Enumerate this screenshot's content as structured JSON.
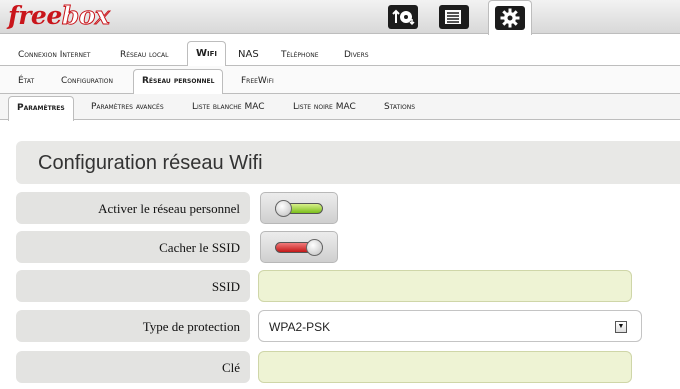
{
  "brand": {
    "logo_free": "free",
    "logo_box": "box"
  },
  "top_icons": [
    {
      "icon": "transfer-icon"
    },
    {
      "icon": "files-icon"
    },
    {
      "icon": "settings-gear-icon",
      "active": true
    }
  ],
  "tabs_primary": [
    "Connexion Internet",
    "Réseau local",
    "Wifi",
    "NAS",
    "Téléphone",
    "Divers"
  ],
  "tabs_secondary": [
    "État",
    "Configuration",
    "Réseau personnel",
    "FreeWifi"
  ],
  "tabs_tertiary": [
    "Paramètres",
    "Paramètres avancés",
    "Liste blanche MAC",
    "Liste noire MAC",
    "Stations"
  ],
  "form": {
    "title": "Configuration réseau Wifi",
    "activate_label": "Activer le réseau personnel",
    "activate_state": "on",
    "hide_ssid_label": "Cacher le SSID",
    "hide_ssid_state": "off",
    "ssid_label": "SSID",
    "ssid_value": "",
    "protection_label": "Type de protection",
    "protection_value": "WPA2-PSK",
    "key_label": "Clé",
    "key_value": ""
  },
  "colors": {
    "brand_red": "#c9151b",
    "toggle_on": "#7bbf1c",
    "toggle_off": "#c41818",
    "field_bg": "#eef3d4"
  }
}
